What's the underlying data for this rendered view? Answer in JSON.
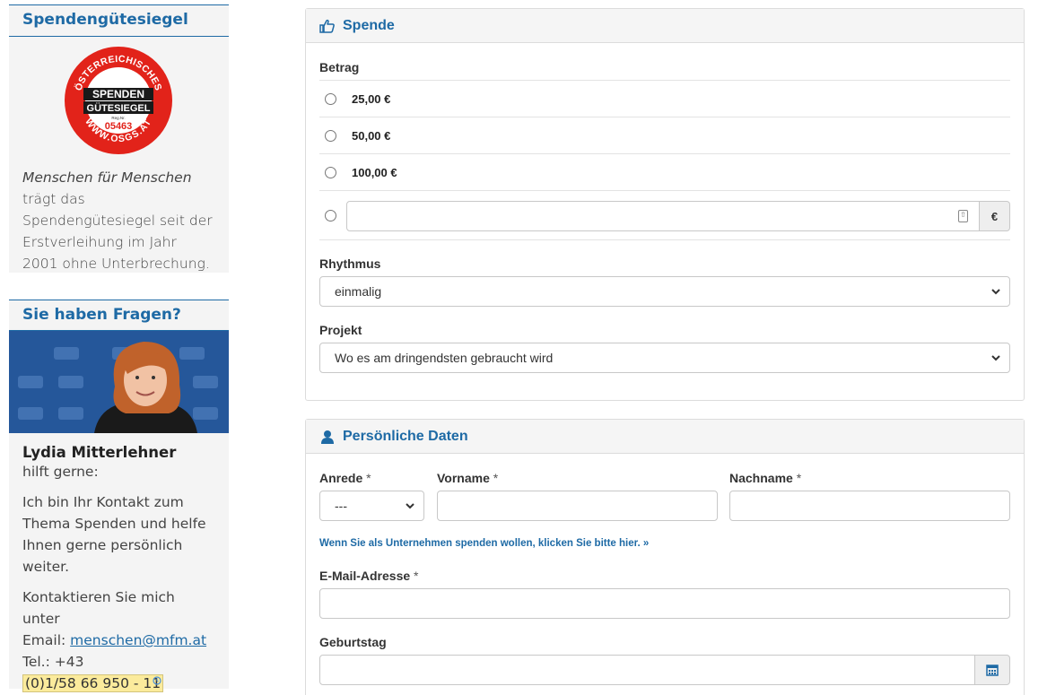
{
  "sidebar": {
    "seal_box": {
      "title": "Spendengütesiegel",
      "seal": {
        "top_text": "ÖSTERREICHISCHES",
        "line1": "SPENDEN",
        "line2": "GÜTESIEGEL",
        "reg": "Reg.Nr.",
        "number": "05463",
        "bottom_text": "WWW.OSGS.AT",
        "color": "#e2231a"
      },
      "text_italic": "Menschen für Menschen",
      "text_rest": " trägt das Spendengütesiegel seit der Erstverleihung im Jahr 2001 ohne Unterbrechung."
    },
    "contact_box": {
      "title": "Sie haben Fragen?",
      "name": "Lydia Mitterlehner",
      "subtitle": "hilft gerne:",
      "paragraph": "Ich bin Ihr Kontakt zum Thema Spenden und helfe Ihnen gerne persönlich weiter.",
      "contact_intro": "Kontaktieren Sie mich unter",
      "email_label": "Email: ",
      "email": "menschen@mfm.at",
      "tel_label": "Tel.: +43",
      "tel_number": "(0)1/58 66 950 - 11"
    }
  },
  "donation": {
    "title": "Spende",
    "amount_label": "Betrag",
    "options": [
      "25,00 €",
      "50,00 €",
      "100,00 €"
    ],
    "currency": "€",
    "rhythm_label": "Rhythmus",
    "rhythm_value": "einmalig",
    "project_label": "Projekt",
    "project_value": "Wo es am dringendsten gebraucht wird"
  },
  "personal": {
    "title": "Persönliche Daten",
    "salutation_label": "Anrede",
    "salutation_value": "---",
    "firstname_label": "Vorname",
    "lastname_label": "Nachname",
    "required_mark": "*",
    "company_link": "Wenn Sie als Unternehmen spenden wollen, klicken Sie bitte hier. »",
    "email_label": "E-Mail-Adresse",
    "birthday_label": "Geburtstag"
  },
  "colors": {
    "accent": "#1e6aa5",
    "sidebar_bg": "#f4f4f4",
    "highlight": "#fbeb9c"
  }
}
